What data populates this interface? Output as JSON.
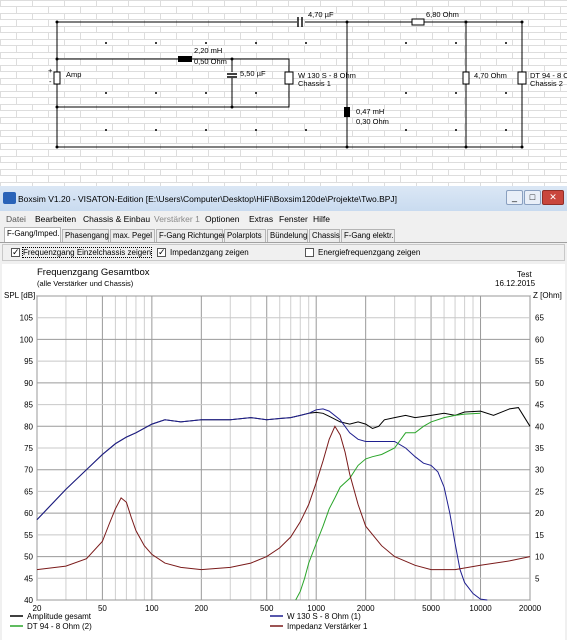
{
  "schematic": {
    "c_series": "4,70 µF",
    "r_series": "6,80 Ohm",
    "l1": "2,20 mH",
    "l1_r": "0,50 Ohm",
    "c_shunt": "5,50 µF",
    "amp": "Amp",
    "plus": "+",
    "minus": "-",
    "chassis1_name": "W 130 S - 8 Ohm",
    "chassis1_label": "Chassis 1",
    "l2": "0,47 mH",
    "l2_r": "0,30 Ohm",
    "r_shunt": "4,70 Ohm",
    "chassis2_name": "DT 94 - 8 O",
    "chassis2_label": "Chassis 2"
  },
  "window": {
    "title": "Boxsim V1.20 - VISATON-Edition [E:\\Users\\Computer\\Desktop\\HiFi\\Boxsim120de\\Projekte\\Two.BPJ]",
    "minimize": "_",
    "maximize": "□",
    "close": "✕"
  },
  "menu": [
    "Datei",
    "Bearbeiten",
    "Chassis & Einbau",
    "Verstärker 1",
    "Optionen",
    "Extras",
    "Fenster",
    "Hilfe"
  ],
  "tabs": [
    "F-Gang/Imped.",
    "Phasengang",
    "max. Pegel",
    "F-Gang Richtungen",
    "Polarplots",
    "Bündelung",
    "Chassis",
    "F-Gang elektr."
  ],
  "options": {
    "einzel_label": "Frequenzgang Einzelchassis zeigen",
    "einzel_checked": "✓",
    "imped_label": "Impedanzgang zeigen",
    "imped_checked": "✓",
    "energie_label": "Energiefrequenzgang zeigen",
    "energie_checked": ""
  },
  "plot_header": {
    "title": "Frequenzgang Gesamtbox",
    "subtitle": "(alle Verstärker und Chassis)",
    "project": "Test",
    "date": "16.12.2015",
    "y_left_label": "SPL [dB]",
    "y_right_label": "Z [Ohm]"
  },
  "legend": [
    {
      "name": "Amplitude gesamt",
      "color": "#000000"
    },
    {
      "name": "W 130 S - 8 Ohm (1)",
      "color": "#1f1f8f"
    },
    {
      "name": "DT 94 - 8 Ohm (2)",
      "color": "#2aa52a"
    },
    {
      "name": "Impedanz Verstärker 1",
      "color": "#7a1a1a"
    }
  ],
  "chart_data": {
    "type": "line",
    "x_scale": "log",
    "xlim": [
      20,
      20000
    ],
    "x_ticks": [
      "20",
      "50",
      "100",
      "200",
      "500",
      "1000",
      "2000",
      "5000",
      "10000",
      "20000"
    ],
    "y_left_lim": [
      40,
      110
    ],
    "y_left_ticks": [
      "40",
      "45",
      "50",
      "55",
      "60",
      "65",
      "70",
      "75",
      "80",
      "85",
      "90",
      "95",
      "100",
      "105"
    ],
    "y_right_lim": [
      0,
      70
    ],
    "y_right_ticks": [
      "5",
      "10",
      "15",
      "20",
      "25",
      "30",
      "35",
      "40",
      "45",
      "50",
      "55",
      "60",
      "65"
    ],
    "series": [
      {
        "name": "Amplitude gesamt",
        "color": "#000000",
        "axis": "left",
        "x": [
          20,
          30,
          40,
          50,
          60,
          70,
          80,
          100,
          120,
          150,
          200,
          300,
          400,
          500,
          600,
          700,
          800,
          900,
          1000,
          1100,
          1200,
          1400,
          1600,
          1800,
          2000,
          2200,
          2400,
          2600,
          3000,
          3500,
          4000,
          5000,
          6000,
          7000,
          8000,
          10000,
          12000,
          15000,
          17000,
          20000
        ],
        "y": [
          58.5,
          65.5,
          70,
          73.5,
          76,
          77.5,
          78.5,
          80.5,
          81.5,
          81,
          81.5,
          81.5,
          82,
          81.5,
          81.8,
          82,
          82.5,
          83,
          83.2,
          83,
          82.3,
          81,
          80.5,
          81,
          80.5,
          79.5,
          80,
          81.5,
          82,
          82.5,
          82,
          82.5,
          83,
          82.5,
          83.3,
          83.5,
          82.5,
          84,
          84.3,
          80
        ]
      },
      {
        "name": "W 130 S - 8 Ohm (1)",
        "color": "#1f1f8f",
        "axis": "left",
        "x": [
          20,
          30,
          40,
          50,
          60,
          70,
          80,
          100,
          120,
          150,
          200,
          300,
          400,
          500,
          600,
          700,
          800,
          900,
          1000,
          1100,
          1200,
          1400,
          1600,
          1800,
          2000,
          2500,
          3000,
          3500,
          4000,
          4500,
          5000,
          5500,
          6000,
          6500,
          7000,
          7500,
          8000,
          9000,
          10000,
          11000
        ],
        "y": [
          58.5,
          65.5,
          70,
          73.5,
          76,
          77.5,
          78.5,
          80.5,
          81.5,
          81,
          81.5,
          81.5,
          82,
          81.5,
          81.8,
          82,
          82.5,
          83,
          83.8,
          84,
          83.5,
          81.5,
          78.5,
          77,
          76.5,
          76.5,
          76.5,
          75,
          73,
          71.5,
          71,
          69.5,
          66,
          60,
          53,
          47,
          44,
          41.5,
          40.2,
          40
        ]
      },
      {
        "name": "DT 94 - 8 Ohm (2)",
        "color": "#2aa52a",
        "axis": "left",
        "x": [
          750,
          800,
          850,
          900,
          1000,
          1100,
          1200,
          1300,
          1400,
          1600,
          1800,
          2000,
          2200,
          2500,
          3000,
          3500,
          4000,
          4500,
          5000,
          6000,
          7000,
          8000,
          10000
        ],
        "y": [
          40,
          42,
          45,
          48.5,
          53,
          57,
          61,
          63.5,
          66,
          68,
          71,
          72.5,
          73,
          73.5,
          75,
          78.5,
          78.5,
          80,
          81,
          82,
          82.5,
          82.8,
          83
        ]
      },
      {
        "name": "Impedanz Verstärker 1",
        "color": "#7a1a1a",
        "axis": "right",
        "x": [
          20,
          30,
          40,
          50,
          55,
          60,
          65,
          70,
          75,
          80,
          90,
          100,
          120,
          150,
          200,
          300,
          400,
          500,
          600,
          700,
          800,
          900,
          1000,
          1100,
          1200,
          1300,
          1400,
          1500,
          1600,
          1800,
          2000,
          2500,
          3000,
          4000,
          5000,
          7000,
          10000,
          15000,
          20000
        ],
        "y": [
          7,
          7.8,
          9.5,
          13.5,
          17.5,
          21,
          23.5,
          22.5,
          19,
          16,
          12.5,
          10.5,
          8.5,
          7.5,
          7,
          7.5,
          8.5,
          10,
          12,
          14.5,
          18,
          22,
          27,
          32,
          37,
          40,
          38,
          34,
          29,
          22,
          17,
          12.5,
          10,
          8,
          7,
          7,
          8,
          9,
          10
        ]
      }
    ],
    "grid": true
  }
}
